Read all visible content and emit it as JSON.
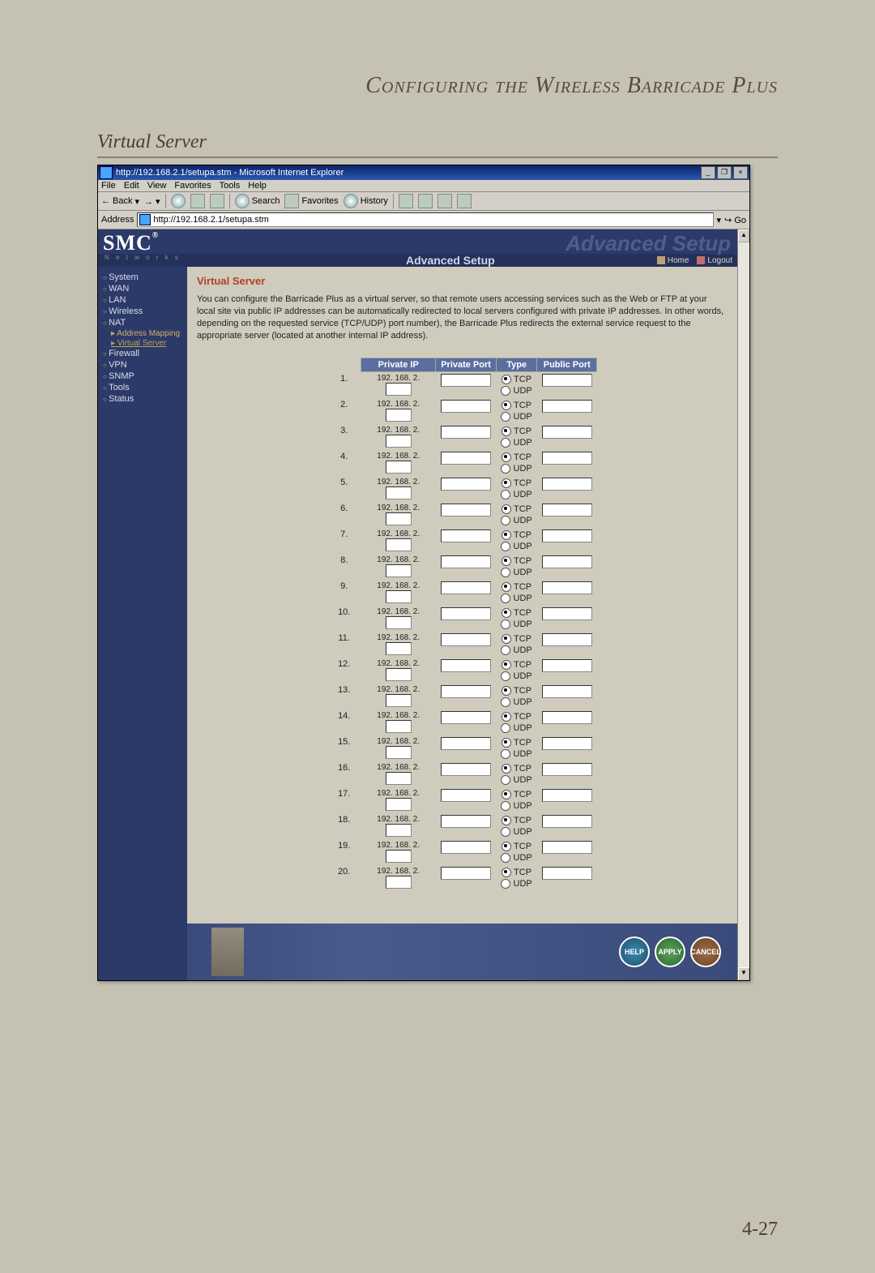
{
  "doc": {
    "header": "Configuring the Wireless Barricade Plus",
    "section": "Virtual Server",
    "page_num": "4-27"
  },
  "window": {
    "title": "http://192.168.2.1/setupa.stm - Microsoft Internet Explorer",
    "menus": [
      "File",
      "Edit",
      "View",
      "Favorites",
      "Tools",
      "Help"
    ],
    "back": "Back",
    "search": "Search",
    "favorites": "Favorites",
    "history": "History",
    "address_label": "Address",
    "address": "http://192.168.2.1/setupa.stm",
    "go": "Go"
  },
  "banner": {
    "logo": "SMC",
    "reg": "®",
    "networks": "N e t w o r k s",
    "ghost": "Advanced Setup",
    "advanced": "Advanced Setup",
    "home": "Home",
    "logout": "Logout"
  },
  "sidebar": {
    "items": [
      "System",
      "WAN",
      "LAN",
      "Wireless",
      "NAT"
    ],
    "subs": [
      "Address Mapping",
      "Virtual Server"
    ],
    "items2": [
      "Firewall",
      "VPN",
      "SNMP",
      "Tools",
      "Status"
    ]
  },
  "main": {
    "title": "Virtual Server",
    "body": "You can configure the Barricade Plus as a virtual server, so that remote users accessing services such as the Web or FTP at your local site via public IP addresses can be automatically redirected to local servers configured with private IP addresses. In other words, depending on the requested service (TCP/UDP) port number), the Barricade Plus redirects the external service request to the appropriate server (located at another internal IP address).",
    "headers": [
      "Private IP",
      "Private Port",
      "Type",
      "Public Port"
    ],
    "ip_prefix": "192. 168. 2.",
    "tcp": "TCP",
    "udp": "UDP",
    "rows": 20
  },
  "buttons": {
    "help": "HELP",
    "apply": "APPLY",
    "cancel": "CANCEL"
  }
}
